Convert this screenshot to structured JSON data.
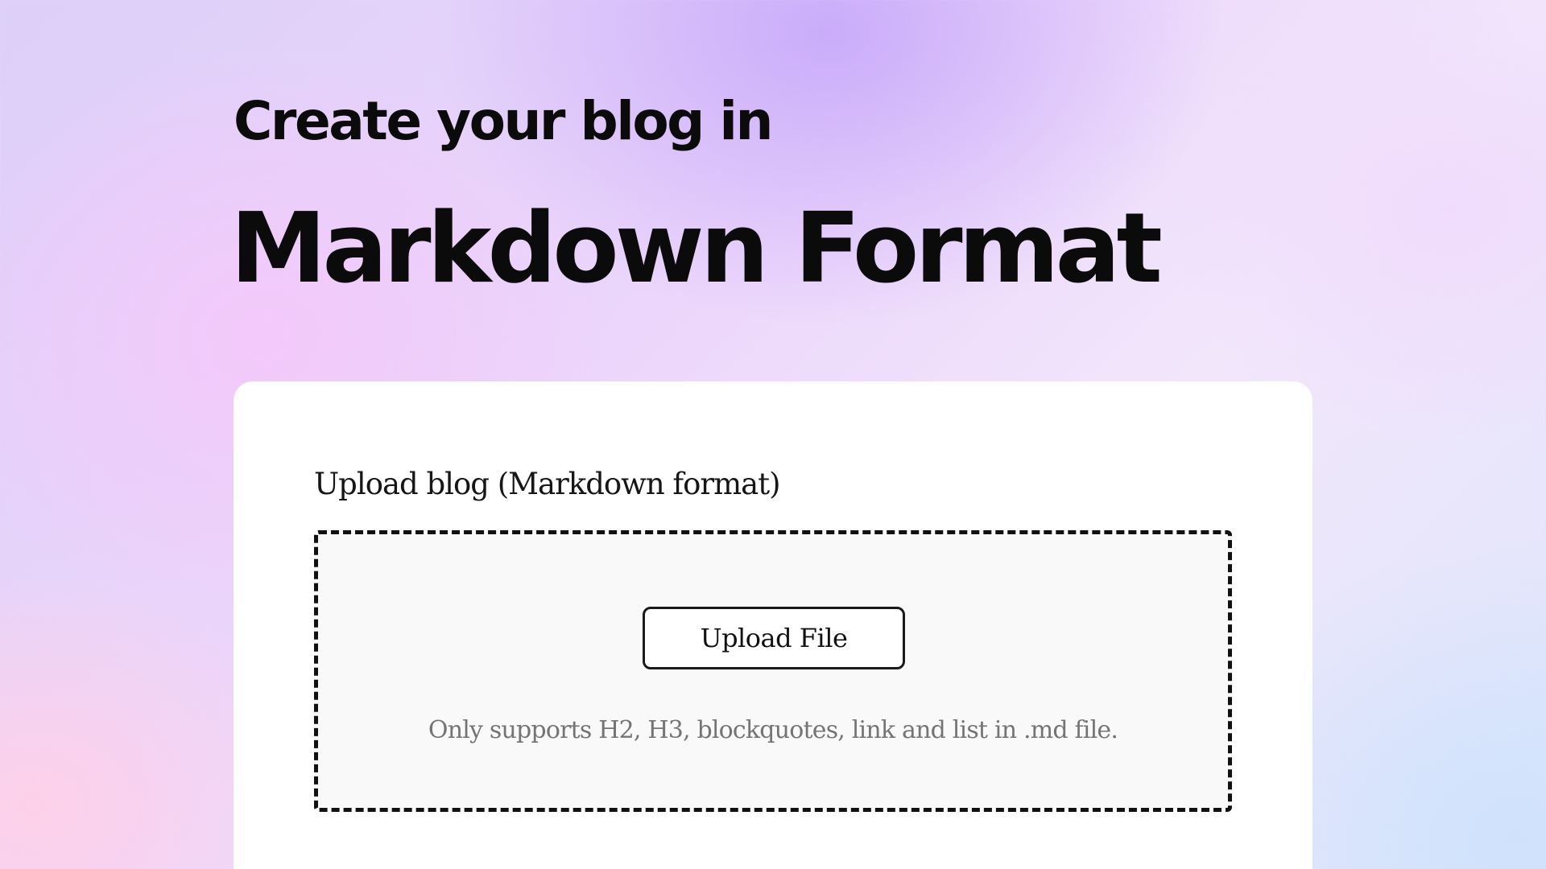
{
  "hero": {
    "line1": "Create your blog in",
    "line2": "Markdown Format"
  },
  "upload": {
    "label": "Upload blog (Markdown format)",
    "button_label": "Upload File",
    "hint": "Only supports H2, H3, blockquotes, link and list in .md file."
  },
  "colors": {
    "text": "#0b0b0b",
    "card_background": "#ffffff",
    "dropzone_background": "#f9f9f9",
    "hint_text": "#747474"
  }
}
